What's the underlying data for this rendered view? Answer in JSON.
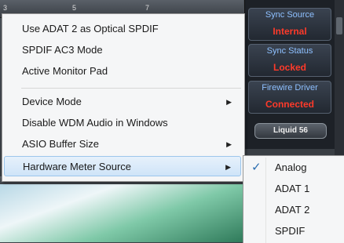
{
  "background": {
    "channel_numbers": [
      "3",
      "5",
      "7"
    ],
    "status_panel": {
      "sync_source_label": "Sync Source",
      "sync_source_value": "Internal",
      "sync_status_label": "Sync Status",
      "sync_status_value": "Locked",
      "firewire_label": "Firewire Driver",
      "firewire_value": "Connected",
      "device_name": "Liquid 56"
    }
  },
  "menu": {
    "items": [
      {
        "label": "Use ADAT 2 as Optical SPDIF",
        "has_submenu": false
      },
      {
        "label": "SPDIF AC3 Mode",
        "has_submenu": false
      },
      {
        "label": "Active Monitor Pad",
        "has_submenu": false
      },
      {
        "label": "Device Mode",
        "has_submenu": true
      },
      {
        "label": "Disable WDM Audio in Windows",
        "has_submenu": false
      },
      {
        "label": "ASIO Buffer Size",
        "has_submenu": true
      },
      {
        "label": "Hardware Meter Source",
        "has_submenu": true,
        "highlighted": true
      }
    ],
    "submenu_arrow_icon": "chevron-right-icon"
  },
  "submenu": {
    "items": [
      {
        "label": "Analog",
        "checked": true
      },
      {
        "label": "ADAT 1",
        "checked": false
      },
      {
        "label": "ADAT 2",
        "checked": false
      },
      {
        "label": "SPDIF",
        "checked": false
      }
    ],
    "check_icon": "checkmark-icon"
  },
  "colors": {
    "status_label": "#8ec0ff",
    "status_value": "#ff3a2a",
    "menu_highlight": "#cfe4f8",
    "check_mark": "#2a6db0"
  }
}
